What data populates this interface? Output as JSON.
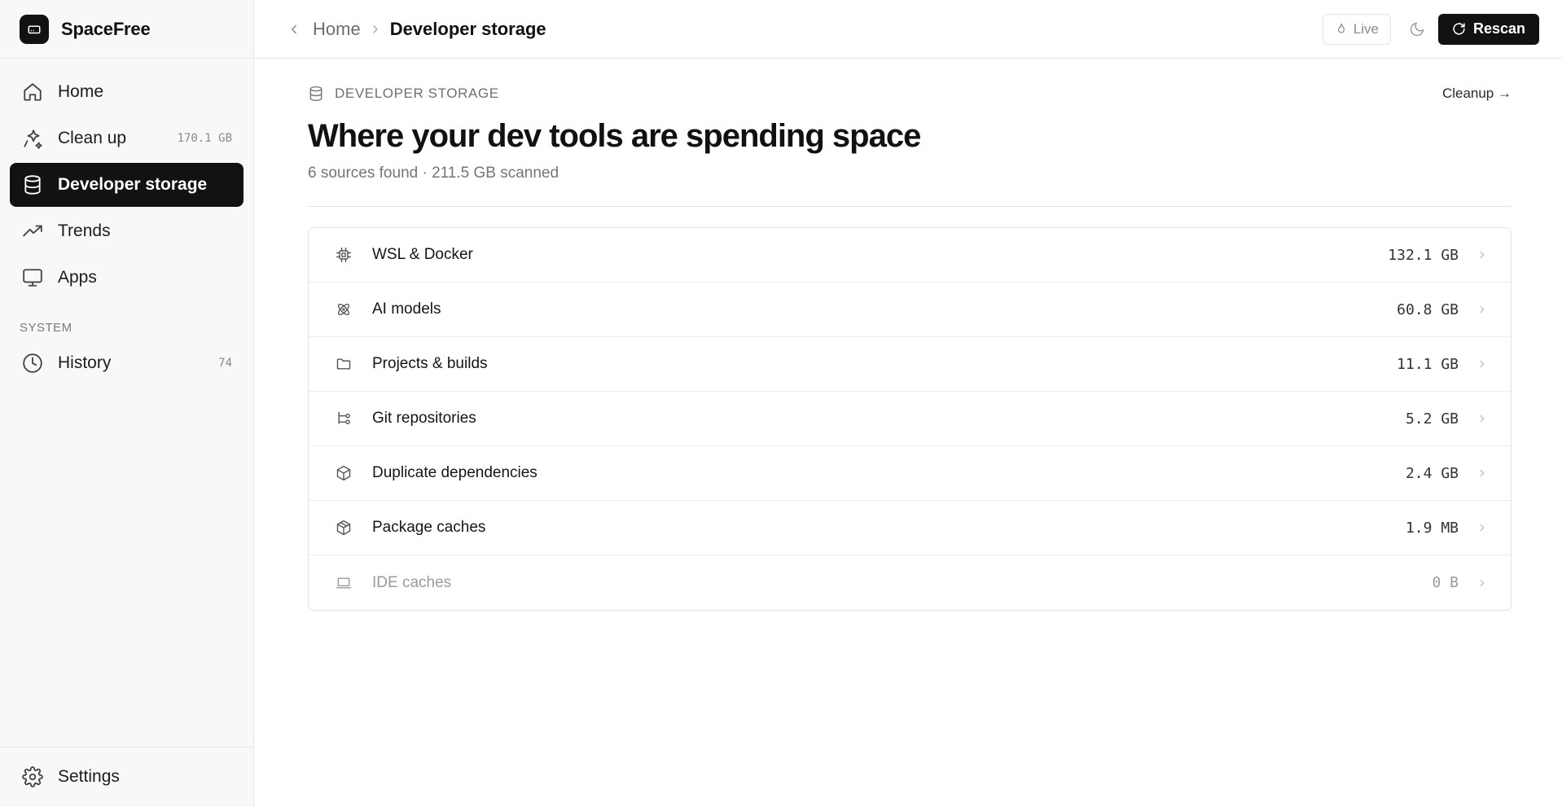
{
  "app": {
    "name": "SpaceFree"
  },
  "sidebar": {
    "items": [
      {
        "label": "Home",
        "count": ""
      },
      {
        "label": "Clean up",
        "count": "170.1 GB"
      },
      {
        "label": "Developer storage",
        "count": ""
      },
      {
        "label": "Trends",
        "count": ""
      },
      {
        "label": "Apps",
        "count": ""
      }
    ],
    "system_label": "SYSTEM",
    "system_items": [
      {
        "label": "History",
        "count": "74"
      }
    ],
    "footer": {
      "label": "Settings"
    }
  },
  "topbar": {
    "breadcrumb_home": "Home",
    "breadcrumb_current": "Developer storage",
    "live_label": "Live",
    "rescan_label": "Rescan"
  },
  "page": {
    "eyebrow": "DEVELOPER STORAGE",
    "cleanup_link": "Cleanup →",
    "title": "Where your dev tools are spending space",
    "subtitle": "6 sources found · 211.5 GB scanned"
  },
  "sources": [
    {
      "name": "WSL & Docker",
      "size": "132.1 GB",
      "icon": "cpu-icon"
    },
    {
      "name": "AI models",
      "size": "60.8 GB",
      "icon": "atom-icon"
    },
    {
      "name": "Projects & builds",
      "size": "11.1 GB",
      "icon": "folder-icon"
    },
    {
      "name": "Git repositories",
      "size": "5.2 GB",
      "icon": "git-branch-icon"
    },
    {
      "name": "Duplicate dependencies",
      "size": "2.4 GB",
      "icon": "box-icon"
    },
    {
      "name": "Package caches",
      "size": "1.9 MB",
      "icon": "package-icon"
    },
    {
      "name": "IDE caches",
      "size": "0 B",
      "icon": "laptop-icon"
    }
  ],
  "colors": {
    "accent": "#121212",
    "muted": "#757575",
    "border": "#e3e3e3",
    "sidebar_bg": "#f8f8f8"
  }
}
